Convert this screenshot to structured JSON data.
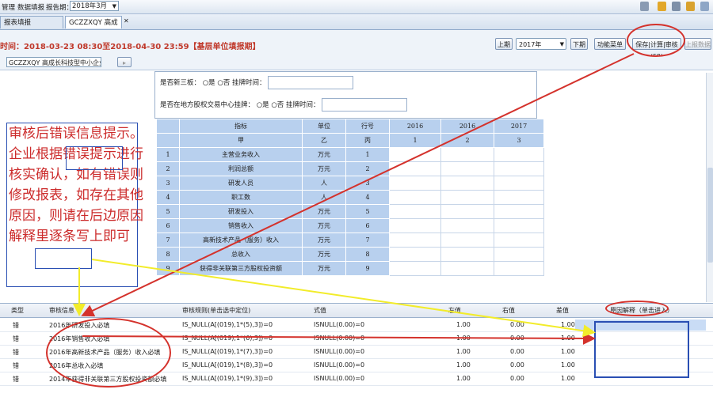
{
  "topbar": {
    "menu_left": "管理",
    "menu_data_fill": "数据填报",
    "period_label": "报告期：",
    "period_value": "2018年3月"
  },
  "tabs": [
    {
      "label": "报表填报"
    },
    {
      "label": "GCZZXQY 高成长I"
    }
  ],
  "infobar": {
    "fill_time": "时间：2018-03-23 08:30至2018-04-30 23:59【基层单位填报期】",
    "prev_button": "上期",
    "year_value": "2017年",
    "next_button": "下期",
    "function_menu": "功能菜单",
    "save_audit_button": "保存|计算|审核(F8)",
    "submit_button": "上报数据"
  },
  "enterprise": {
    "select_value": "GCZZXQY 高成长科技型中小企业"
  },
  "form": {
    "q1_label": "是否新三板：",
    "q1_yes": "是",
    "q1_no": "否",
    "q1_time_label": "挂牌时间：",
    "q2_label": "是否在地方股权交易中心挂牌：",
    "q2_yes": "是",
    "q2_no": "否",
    "q2_time_label": "挂牌时间："
  },
  "table": {
    "headers": [
      "指标",
      "单位",
      "行号",
      "2016",
      "2016",
      "2017"
    ],
    "subheaders": [
      "甲",
      "乙",
      "丙",
      "1",
      "2",
      "3"
    ],
    "rows": [
      {
        "no": "1",
        "name": "主营业务收入",
        "unit": "万元",
        "line": "1"
      },
      {
        "no": "2",
        "name": "利润总额",
        "unit": "万元",
        "line": "2"
      },
      {
        "no": "3",
        "name": "研发人员",
        "unit": "人",
        "line": "3"
      },
      {
        "no": "4",
        "name": "职工数",
        "unit": "人",
        "line": "4"
      },
      {
        "no": "5",
        "name": "研发投入",
        "unit": "万元",
        "line": "5"
      },
      {
        "no": "6",
        "name": "销售收入",
        "unit": "万元",
        "line": "6"
      },
      {
        "no": "7",
        "name": "高新技术产品（服务）收入",
        "unit": "万元",
        "line": "7"
      },
      {
        "no": "8",
        "name": "总收入",
        "unit": "万元",
        "line": "8"
      },
      {
        "no": "9",
        "name": "获得非关联第三方股权投资额",
        "unit": "万元",
        "line": "9"
      }
    ]
  },
  "annotation": {
    "text": "审核后错误信息提示。企业根据错误提示进行核实确认，如有错误则修改报表，如存在其他原因，则请在后边原因解释里逐条写上即可"
  },
  "errors": {
    "headers": {
      "type": "类型",
      "info": "审核信息",
      "rule": "审核规则(单击选中定位)",
      "expr": "式值",
      "left": "左值",
      "right": "右值",
      "diff": "差值",
      "reason": "原因解释（单击进入）"
    },
    "rows": [
      {
        "type": "错",
        "info": "2016年研发投入必填",
        "rule": "IS_NULL(A[(019),1*(5),3])=0",
        "expr": "ISNULL(0.00)=0",
        "left": "1.00",
        "right": "0.00",
        "diff": "1.00"
      },
      {
        "type": "错",
        "info": "2016年销售收入必填",
        "rule": "IS_NULL(A[(019),1*(6),3])=0",
        "expr": "ISNULL(0.00)=0",
        "left": "1.00",
        "right": "0.00",
        "diff": "1.00"
      },
      {
        "type": "错",
        "info": "2016年高新技术产品（服务）收入必填",
        "rule": "IS_NULL(A[(019),1*(7),3])=0",
        "expr": "ISNULL(0.00)=0",
        "left": "1.00",
        "right": "0.00",
        "diff": "1.00"
      },
      {
        "type": "错",
        "info": "2016年总收入必填",
        "rule": "IS_NULL(A[(019),1*(8),3])=0",
        "expr": "ISNULL(0.00)=0",
        "left": "1.00",
        "right": "0.00",
        "diff": "1.00"
      },
      {
        "type": "错",
        "info": "2014年获得非关联第三方股权投资额必填",
        "rule": "IS_NULL(A[(019),1*(9),3])=0",
        "expr": "ISNULL(0.00)=0",
        "left": "1.00",
        "right": "0.00",
        "diff": "1.00"
      }
    ]
  },
  "colors": {
    "annotation_red": "#cc2b2b",
    "highlight_blue": "#2a4fb3",
    "arrow_yellow": "#f2ec2a",
    "table_header_blue": "#b8d0ee"
  }
}
